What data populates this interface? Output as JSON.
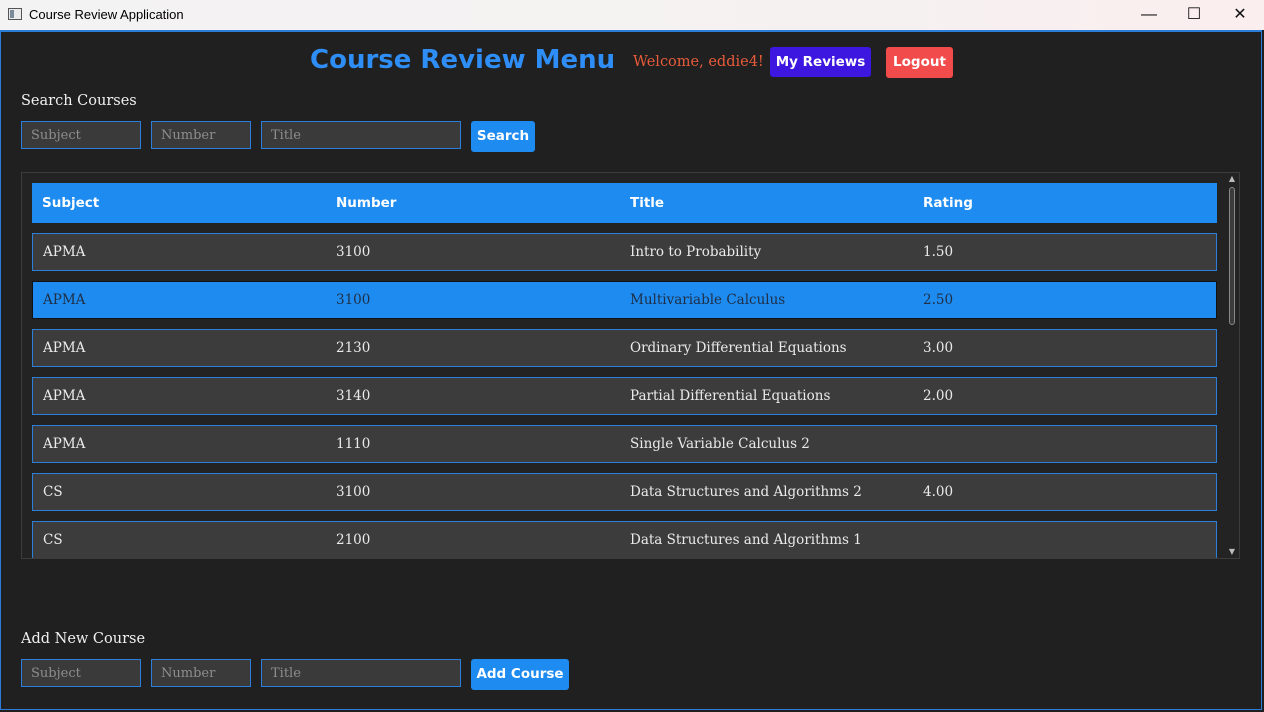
{
  "window": {
    "title": "Course Review Application",
    "controls": {
      "minimize": "—",
      "maximize": "☐",
      "close": "✕"
    }
  },
  "header": {
    "title": "Course Review Menu",
    "welcome": "Welcome, eddie4!",
    "my_reviews_label": "My Reviews",
    "logout_label": "Logout"
  },
  "search": {
    "section_label": "Search Courses",
    "subject_placeholder": "Subject",
    "number_placeholder": "Number",
    "title_placeholder": "Title",
    "button_label": "Search"
  },
  "table": {
    "columns": [
      "Subject",
      "Number",
      "Title",
      "Rating"
    ],
    "rows": [
      {
        "subject": "APMA",
        "number": "3100",
        "title": "Intro to Probability",
        "rating": "1.50",
        "selected": false
      },
      {
        "subject": "APMA",
        "number": "3100",
        "title": "Multivariable Calculus",
        "rating": "2.50",
        "selected": true
      },
      {
        "subject": "APMA",
        "number": "2130",
        "title": "Ordinary Differential Equations",
        "rating": "3.00",
        "selected": false
      },
      {
        "subject": "APMA",
        "number": "3140",
        "title": "Partial Differential Equations",
        "rating": "2.00",
        "selected": false
      },
      {
        "subject": "APMA",
        "number": "1110",
        "title": "Single Variable Calculus 2",
        "rating": "",
        "selected": false
      },
      {
        "subject": "CS",
        "number": "3100",
        "title": "Data Structures and Algorithms 2",
        "rating": "4.00",
        "selected": false
      },
      {
        "subject": "CS",
        "number": "2100",
        "title": "Data Structures and Algorithms 1",
        "rating": "",
        "selected": false
      }
    ]
  },
  "add_course": {
    "section_label": "Add New Course",
    "subject_placeholder": "Subject",
    "number_placeholder": "Number",
    "title_placeholder": "Title",
    "button_label": "Add Course"
  },
  "colors": {
    "accent": "#1e8bf0",
    "title": "#2e8ef5",
    "welcome": "#e85b3a",
    "my_reviews": "#3d16e0",
    "logout": "#f24b4b",
    "background": "#1f1f1f"
  }
}
